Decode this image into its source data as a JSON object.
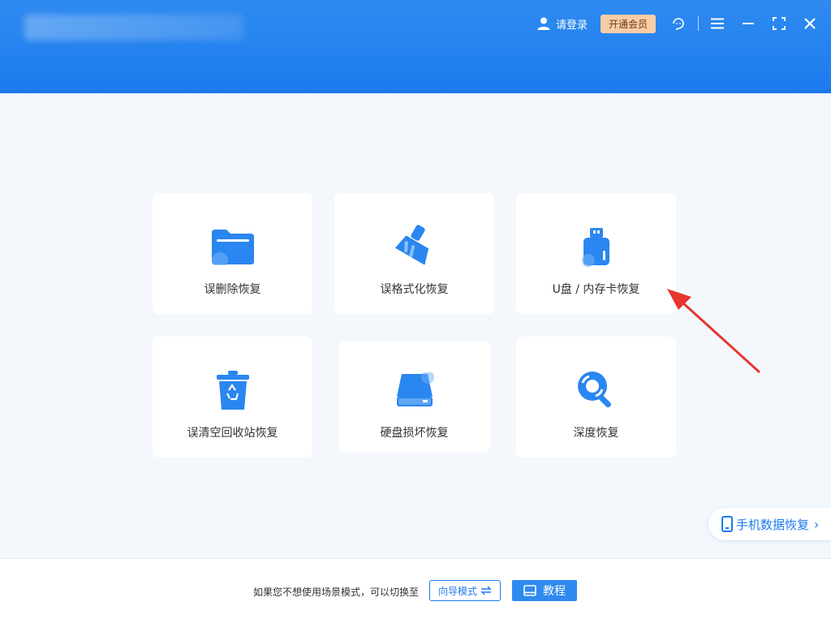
{
  "header": {
    "login_label": "请登录",
    "vip_label": "开通会员"
  },
  "cards": [
    {
      "label": "误删除恢复",
      "icon": "folder-icon"
    },
    {
      "label": "误格式化恢复",
      "icon": "broom-icon"
    },
    {
      "label": "U盘 / 内存卡恢复",
      "icon": "usb-drive-icon"
    },
    {
      "label": "误清空回收站恢复",
      "icon": "recycle-bin-icon"
    },
    {
      "label": "硬盘损坏恢复",
      "icon": "hard-disk-icon"
    },
    {
      "label": "深度恢复",
      "icon": "magnifier-icon"
    }
  ],
  "phone_recovery": {
    "label": "手机数据恢复"
  },
  "footer": {
    "hint": "如果您不想使用场景模式，可以切换至",
    "guide_label": "向导模式",
    "tutorial_label": "教程"
  },
  "colors": {
    "brand": "#1c7aee",
    "header_top": "#2f8bf0",
    "vip_bg": "#f8cda6",
    "arrow": "#e8362f",
    "page_bg": "#f4f8fd"
  }
}
